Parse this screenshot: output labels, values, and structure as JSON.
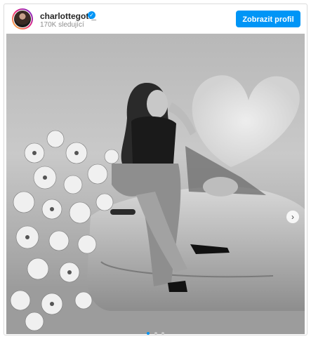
{
  "post": {
    "username": "charlottegott_",
    "followers": "170K sledující",
    "profile_button": "Zobrazit profil",
    "carousel_dots": 3,
    "active_slide": 1
  },
  "icons": {
    "verified": "verified-badge-icon",
    "next": "chevron-right-icon"
  },
  "colors": {
    "accent": "#0095f6",
    "border": "#dbdbdb",
    "muted_text": "#8e8e8e"
  }
}
